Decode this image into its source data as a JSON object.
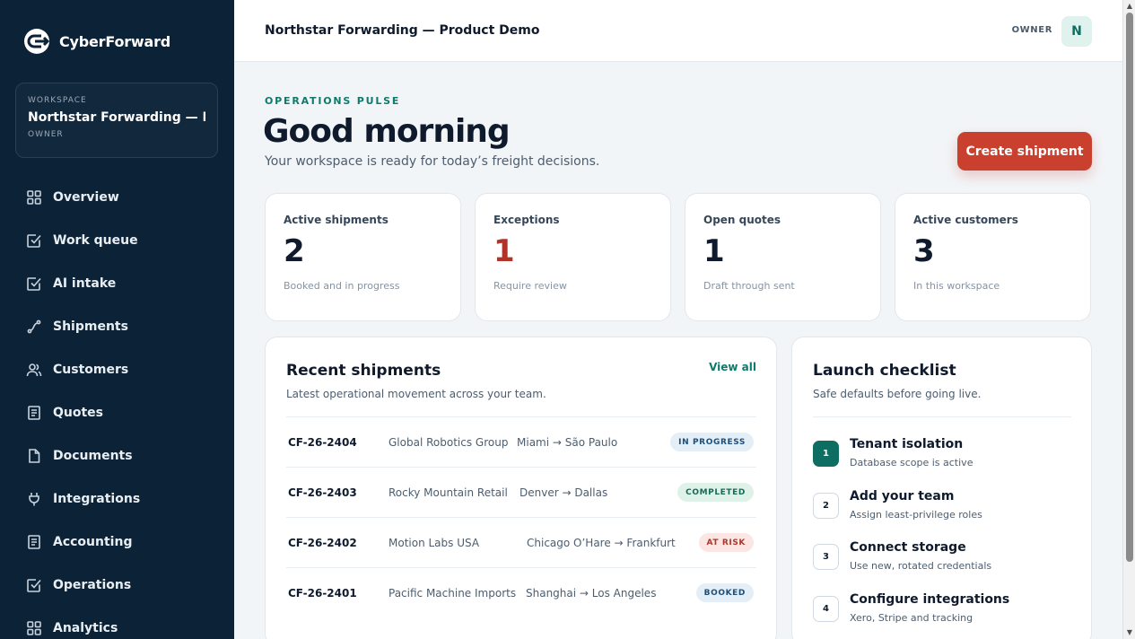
{
  "brand": {
    "name": "CyberForward"
  },
  "workspace": {
    "kicker": "WORKSPACE",
    "name": "Northstar Forwarding — P...",
    "role": "OWNER"
  },
  "nav": [
    {
      "label": "Overview",
      "icon": "grid-icon"
    },
    {
      "label": "Work queue",
      "icon": "checkbox-icon"
    },
    {
      "label": "AI intake",
      "icon": "checkbox-icon"
    },
    {
      "label": "Shipments",
      "icon": "route-icon"
    },
    {
      "label": "Customers",
      "icon": "users-icon"
    },
    {
      "label": "Quotes",
      "icon": "document-list-icon"
    },
    {
      "label": "Documents",
      "icon": "file-icon"
    },
    {
      "label": "Integrations",
      "icon": "plug-icon"
    },
    {
      "label": "Accounting",
      "icon": "document-list-icon"
    },
    {
      "label": "Operations",
      "icon": "checkbox-icon"
    },
    {
      "label": "Analytics",
      "icon": "grid-icon"
    }
  ],
  "header": {
    "title": "Northstar Forwarding — Product Demo",
    "role": "OWNER",
    "avatar_initial": "N"
  },
  "hero": {
    "kicker": "OPERATIONS PULSE",
    "greeting": "Good morning",
    "subtitle": "Your workspace is ready for today’s freight decisions.",
    "create_label": "Create shipment"
  },
  "stats": [
    {
      "label": "Active shipments",
      "value": "2",
      "note": "Booked and in progress"
    },
    {
      "label": "Exceptions",
      "value": "1",
      "note": "Require review"
    },
    {
      "label": "Open quotes",
      "value": "1",
      "note": "Draft through sent"
    },
    {
      "label": "Active customers",
      "value": "3",
      "note": "In this workspace"
    }
  ],
  "recent": {
    "title": "Recent shipments",
    "subtitle": "Latest operational movement across your team.",
    "view_all": "View all",
    "rows": [
      {
        "id": "CF-26-2404",
        "customer": "Global Robotics Group",
        "route": "Miami → São Paulo",
        "status": "IN PROGRESS"
      },
      {
        "id": "CF-26-2403",
        "customer": "Rocky Mountain Retail",
        "route": "Denver → Dallas",
        "status": "COMPLETED"
      },
      {
        "id": "CF-26-2402",
        "customer": "Motion Labs USA",
        "route": "Chicago O’Hare → Frankfurt",
        "status": "AT RISK"
      },
      {
        "id": "CF-26-2401",
        "customer": "Pacific Machine Imports",
        "route": "Shanghai → Los Angeles",
        "status": "BOOKED"
      }
    ]
  },
  "checklist": {
    "title": "Launch checklist",
    "subtitle": "Safe defaults before going live.",
    "items": [
      {
        "step": "1",
        "title": "Tenant isolation",
        "desc": "Database scope is active"
      },
      {
        "step": "2",
        "title": "Add your team",
        "desc": "Assign least-privilege roles"
      },
      {
        "step": "3",
        "title": "Connect storage",
        "desc": "Use new, rotated credentials"
      },
      {
        "step": "4",
        "title": "Configure integrations",
        "desc": "Xero, Stripe and tracking"
      }
    ]
  },
  "colors": {
    "sidebar": "#0c2237",
    "accent": "#0e7a6c",
    "primary_button": "#c9412e",
    "alert": "#b0342a"
  }
}
